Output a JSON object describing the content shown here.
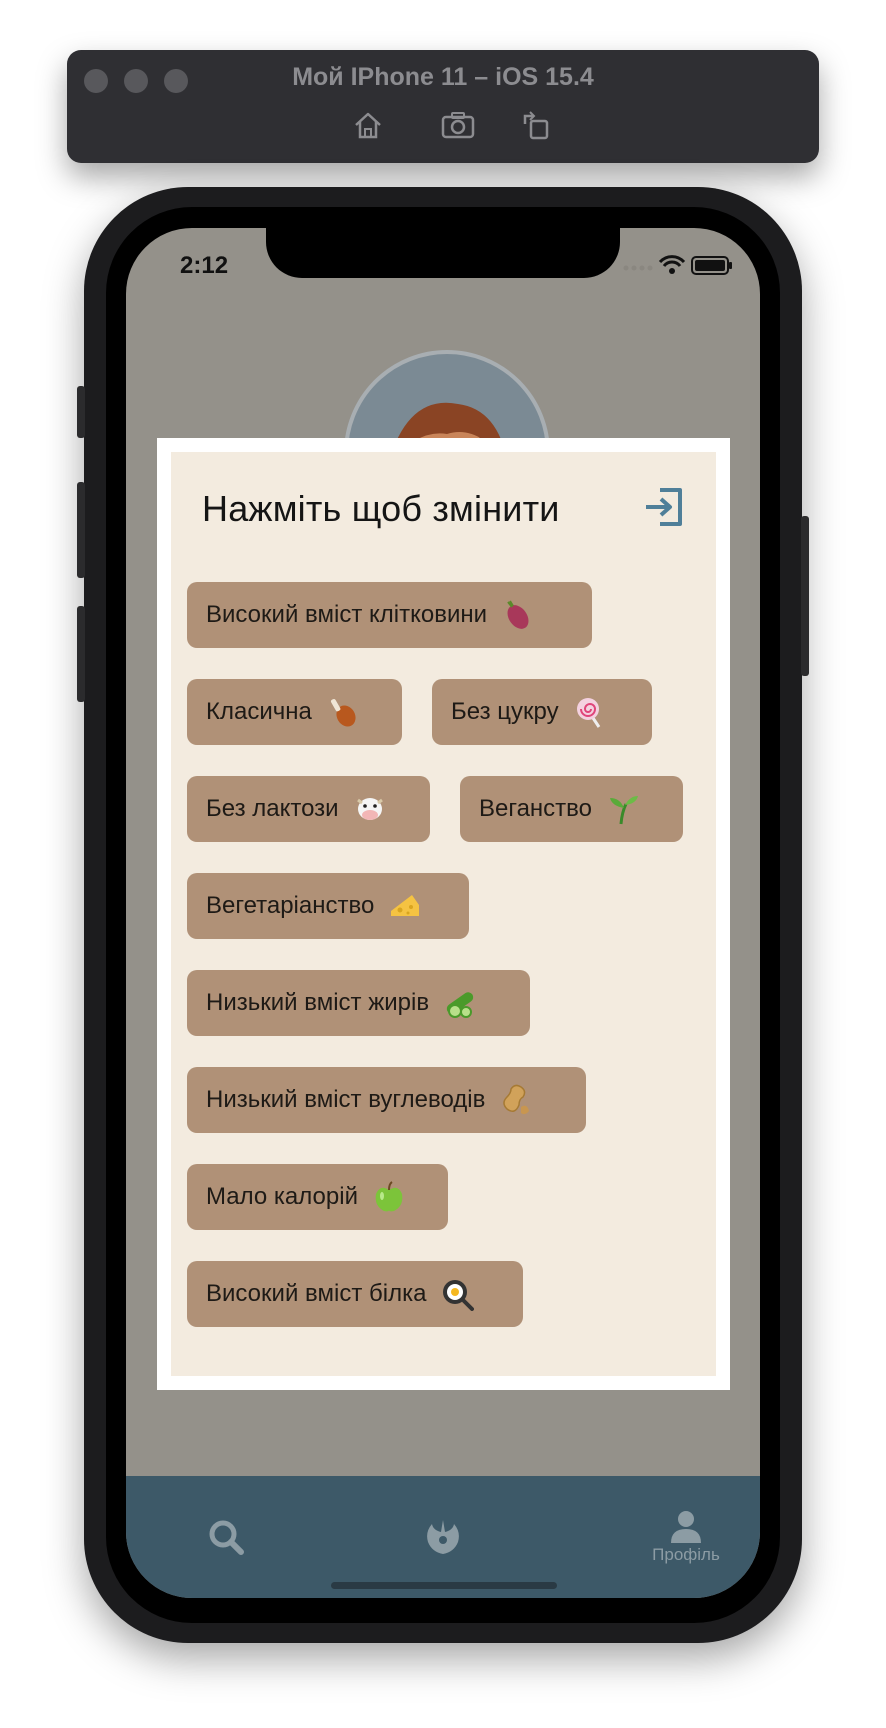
{
  "simulator": {
    "title": "Мой IPhone 11 – iOS 15.4",
    "tools": [
      "home-icon",
      "screenshot-icon",
      "rotate-icon"
    ]
  },
  "status_bar": {
    "time": "2:12"
  },
  "modal": {
    "title": "Нажміть щоб змінити",
    "exit_icon": "exit-icon",
    "tags": [
      {
        "label": "Високий вміст клітковини",
        "emoji": "sweet-potato"
      },
      {
        "label": "Класична",
        "emoji": "poultry-leg"
      },
      {
        "label": "Без цукру",
        "emoji": "lollipop"
      },
      {
        "label": "Без лактози",
        "emoji": "cow-face"
      },
      {
        "label": "Веганство",
        "emoji": "seedling"
      },
      {
        "label": "Вегетаріанство",
        "emoji": "cheese"
      },
      {
        "label": "Низький вміст жирів",
        "emoji": "cucumber"
      },
      {
        "label": "Низький вміст вуглеводів",
        "emoji": "peanuts"
      },
      {
        "label": "Мало калорій",
        "emoji": "green-apple"
      },
      {
        "label": "Високий вміст білка",
        "emoji": "fried-egg"
      }
    ]
  },
  "tabbar": {
    "tabs": [
      {
        "icon": "search-icon",
        "label": ""
      },
      {
        "icon": "rebel-alliance-icon",
        "label": ""
      },
      {
        "icon": "person-icon",
        "label": "Профіль"
      }
    ]
  },
  "colors": {
    "background_dim": "#94918a",
    "modal_background": "#f3ebdf",
    "tag_background": "#b09177",
    "tabbar": "#3d5968",
    "exit_icon": "#4f7f99"
  }
}
